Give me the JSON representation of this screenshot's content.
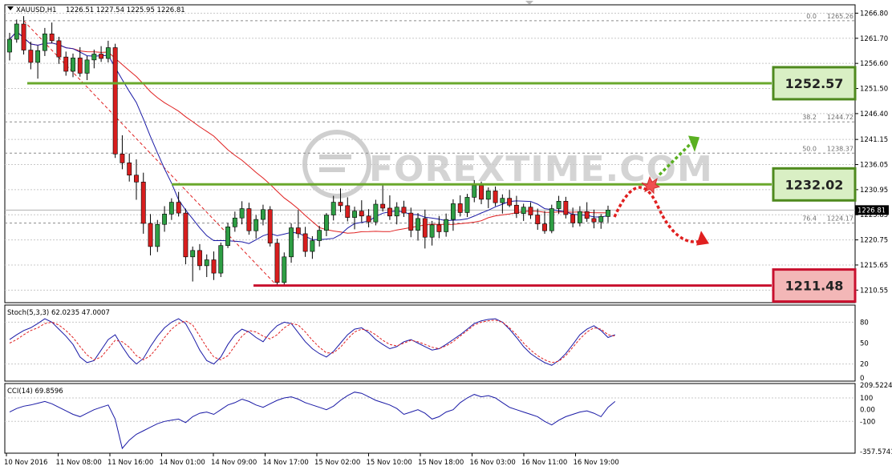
{
  "chart_data": [
    {
      "type": "candlestick",
      "title": "XAUUSD,H1",
      "ohlc_header": "1226.51 1227.54 1225.95 1226.81",
      "symbol": "XAUUSD",
      "timeframe": "H1",
      "last_price": "1226.81",
      "ylim": [
        1208.0,
        1268.5
      ],
      "y_tick_labels": [
        "1266.80",
        "1261.70",
        "1256.60",
        "1251.50",
        "1246.40",
        "1241.15",
        "1236.05",
        "1230.95",
        "1225.85",
        "1220.75",
        "1215.65",
        "1210.55"
      ],
      "x_tick_labels": [
        "10 Nov 2016",
        "11 Nov 08:00",
        "11 Nov 16:00",
        "14 Nov 01:00",
        "14 Nov 09:00",
        "14 Nov 17:00",
        "15 Nov 02:00",
        "15 Nov 10:00",
        "15 Nov 18:00",
        "16 Nov 03:00",
        "16 Nov 11:00",
        "16 Nov 19:00"
      ],
      "fibonacci_levels": [
        {
          "label": "0.0",
          "price": "1265.26",
          "value": 1265.26
        },
        {
          "label": "38.2",
          "price": "1244.72",
          "value": 1244.72
        },
        {
          "label": "50.0",
          "price": "1238.37",
          "value": 1238.37
        },
        {
          "label": "76.4",
          "price": "1224.17",
          "value": 1224.17
        }
      ],
      "key_levels": [
        {
          "label": "1252.57",
          "value": 1252.57,
          "kind": "resistance"
        },
        {
          "label": "1232.02",
          "value": 1232.02,
          "kind": "pivot"
        },
        {
          "label": "1211.48",
          "value": 1211.48,
          "kind": "support"
        }
      ],
      "candles": [
        [
          1258.9,
          1262.8,
          1257.2,
          1261.5
        ],
        [
          1261.5,
          1265.5,
          1260.8,
          1264.6
        ],
        [
          1264.6,
          1266.2,
          1258.4,
          1259.3
        ],
        [
          1259.3,
          1261.0,
          1255.4,
          1256.8
        ],
        [
          1256.8,
          1260.2,
          1253.5,
          1259.2
        ],
        [
          1259.2,
          1263.8,
          1258.1,
          1262.6
        ],
        [
          1262.6,
          1264.9,
          1260.7,
          1261.2
        ],
        [
          1261.2,
          1262.0,
          1256.5,
          1257.9
        ],
        [
          1257.9,
          1259.0,
          1254.1,
          1255.0
        ],
        [
          1255.0,
          1258.6,
          1253.8,
          1257.7
        ],
        [
          1257.7,
          1259.9,
          1253.9,
          1254.6
        ],
        [
          1254.6,
          1258.1,
          1253.2,
          1257.3
        ],
        [
          1257.3,
          1259.4,
          1255.6,
          1258.5
        ],
        [
          1258.5,
          1260.1,
          1256.9,
          1257.6
        ],
        [
          1257.6,
          1261.2,
          1256.8,
          1259.8
        ],
        [
          1259.8,
          1260.6,
          1237.4,
          1238.2
        ],
        [
          1238.2,
          1242.0,
          1235.1,
          1236.4
        ],
        [
          1236.4,
          1238.3,
          1232.6,
          1233.9
        ],
        [
          1233.9,
          1237.1,
          1228.9,
          1232.5
        ],
        [
          1232.5,
          1234.4,
          1222.0,
          1224.1
        ],
        [
          1224.1,
          1226.0,
          1217.6,
          1219.4
        ],
        [
          1219.4,
          1224.8,
          1218.3,
          1223.9
        ],
        [
          1223.9,
          1227.6,
          1222.4,
          1226.0
        ],
        [
          1226.0,
          1229.2,
          1224.8,
          1228.4
        ],
        [
          1228.4,
          1230.5,
          1225.5,
          1226.2
        ],
        [
          1226.2,
          1227.1,
          1215.8,
          1217.3
        ],
        [
          1217.3,
          1219.4,
          1212.3,
          1218.6
        ],
        [
          1218.6,
          1219.9,
          1214.6,
          1215.5
        ],
        [
          1215.5,
          1217.8,
          1213.2,
          1216.7
        ],
        [
          1216.7,
          1218.4,
          1212.6,
          1214.0
        ],
        [
          1214.0,
          1220.2,
          1213.2,
          1219.6
        ],
        [
          1219.6,
          1224.2,
          1219.1,
          1223.4
        ],
        [
          1223.4,
          1226.5,
          1222.4,
          1225.2
        ],
        [
          1225.2,
          1228.6,
          1223.9,
          1227.1
        ],
        [
          1227.1,
          1228.3,
          1221.8,
          1222.6
        ],
        [
          1222.6,
          1225.8,
          1221.0,
          1224.9
        ],
        [
          1224.9,
          1227.9,
          1223.7,
          1226.9
        ],
        [
          1226.9,
          1227.6,
          1219.4,
          1220.1
        ],
        [
          1220.1,
          1221.0,
          1211.4,
          1212.1
        ],
        [
          1212.1,
          1218.2,
          1211.6,
          1217.3
        ],
        [
          1217.3,
          1224.1,
          1216.1,
          1223.2
        ],
        [
          1223.2,
          1226.8,
          1221.1,
          1222.0
        ],
        [
          1222.0,
          1223.4,
          1217.3,
          1218.4
        ],
        [
          1218.4,
          1221.5,
          1216.9,
          1220.6
        ],
        [
          1220.6,
          1223.6,
          1219.4,
          1222.7
        ],
        [
          1222.7,
          1226.2,
          1221.5,
          1225.8
        ],
        [
          1225.8,
          1229.7,
          1224.7,
          1228.4
        ],
        [
          1228.4,
          1231.2,
          1226.4,
          1227.7
        ],
        [
          1227.7,
          1229.4,
          1224.5,
          1225.3
        ],
        [
          1225.3,
          1227.5,
          1222.9,
          1226.6
        ],
        [
          1226.6,
          1228.8,
          1224.4,
          1225.6
        ],
        [
          1225.6,
          1227.0,
          1223.3,
          1224.4
        ],
        [
          1224.4,
          1228.9,
          1223.7,
          1228.0
        ],
        [
          1228.0,
          1232.1,
          1226.5,
          1227.2
        ],
        [
          1227.2,
          1229.8,
          1224.8,
          1225.6
        ],
        [
          1225.6,
          1228.4,
          1223.9,
          1227.4
        ],
        [
          1227.4,
          1228.7,
          1225.4,
          1226.2
        ],
        [
          1226.2,
          1227.3,
          1221.3,
          1222.7
        ],
        [
          1222.7,
          1226.2,
          1220.6,
          1225.1
        ],
        [
          1225.1,
          1226.9,
          1219.0,
          1221.3
        ],
        [
          1221.3,
          1224.6,
          1219.6,
          1223.8
        ],
        [
          1223.8,
          1225.6,
          1221.1,
          1222.4
        ],
        [
          1222.4,
          1226.1,
          1221.4,
          1224.9
        ],
        [
          1224.9,
          1229.0,
          1222.6,
          1228.1
        ],
        [
          1228.1,
          1229.8,
          1225.5,
          1226.3
        ],
        [
          1226.3,
          1230.1,
          1225.4,
          1229.4
        ],
        [
          1229.4,
          1232.9,
          1228.4,
          1231.8
        ],
        [
          1231.8,
          1232.6,
          1228.0,
          1229.0
        ],
        [
          1229.0,
          1231.4,
          1227.2,
          1230.7
        ],
        [
          1230.7,
          1231.6,
          1227.6,
          1228.3
        ],
        [
          1228.3,
          1230.0,
          1226.1,
          1229.2
        ],
        [
          1229.2,
          1230.9,
          1227.4,
          1227.8
        ],
        [
          1227.8,
          1229.7,
          1225.2,
          1226.1
        ],
        [
          1226.1,
          1228.1,
          1224.6,
          1227.4
        ],
        [
          1227.4,
          1228.4,
          1225.0,
          1225.8
        ],
        [
          1225.8,
          1227.1,
          1222.8,
          1224.0
        ],
        [
          1224.0,
          1226.6,
          1222.0,
          1222.6
        ],
        [
          1222.6,
          1227.9,
          1222.1,
          1227.1
        ],
        [
          1227.1,
          1229.7,
          1226.0,
          1228.6
        ],
        [
          1228.6,
          1229.5,
          1225.1,
          1225.9
        ],
        [
          1225.9,
          1227.3,
          1223.3,
          1224.2
        ],
        [
          1224.2,
          1227.6,
          1223.5,
          1226.5
        ],
        [
          1226.5,
          1228.4,
          1224.4,
          1225.1
        ],
        [
          1225.1,
          1226.9,
          1223.1,
          1224.4
        ],
        [
          1224.4,
          1226.0,
          1223.0,
          1225.5
        ],
        [
          1225.5,
          1227.7,
          1224.3,
          1226.81
        ]
      ],
      "indicators": [
        {
          "name": "fast_ma",
          "color": "#1a1aa6"
        },
        {
          "name": "slow_ma",
          "color": "#e02020"
        }
      ],
      "forecast_arrows": [
        {
          "direction": "up",
          "color": "#5ab021"
        },
        {
          "direction": "down",
          "color": "#e02020"
        }
      ],
      "watermark": "FOREXTIME.COM"
    },
    {
      "type": "line",
      "title": "Stoch(5,3,3) 62.0235 47.0007",
      "ylim": [
        0,
        100
      ],
      "y_tick_labels": [
        "80",
        "50",
        "20",
        "0"
      ],
      "y_ticks": [
        80,
        50,
        20,
        0
      ],
      "series": [
        {
          "name": "main",
          "color": "#1a1aa6",
          "style": "solid",
          "values": [
            55,
            62,
            68,
            72,
            78,
            85,
            80,
            70,
            60,
            48,
            30,
            22,
            25,
            40,
            55,
            62,
            45,
            30,
            20,
            28,
            45,
            60,
            72,
            80,
            85,
            78,
            60,
            40,
            25,
            20,
            30,
            48,
            62,
            70,
            66,
            58,
            52,
            65,
            75,
            80,
            78,
            65,
            52,
            42,
            35,
            30,
            38,
            50,
            62,
            70,
            72,
            65,
            55,
            48,
            42,
            45,
            52,
            55,
            50,
            45,
            40,
            42,
            48,
            55,
            62,
            70,
            78,
            82,
            84,
            85,
            80,
            70,
            58,
            45,
            35,
            28,
            22,
            18,
            25,
            35,
            48,
            62,
            70,
            75,
            68,
            58,
            62
          ]
        },
        {
          "name": "signal",
          "color": "#e02020",
          "style": "dashed",
          "values": [
            50,
            55,
            62,
            68,
            72,
            78,
            80,
            76,
            68,
            58,
            45,
            33,
            26,
            30,
            42,
            54,
            52,
            44,
            32,
            26,
            32,
            44,
            58,
            70,
            78,
            82,
            76,
            60,
            44,
            30,
            26,
            32,
            46,
            60,
            68,
            66,
            60,
            56,
            62,
            72,
            78,
            76,
            66,
            54,
            44,
            36,
            36,
            44,
            56,
            66,
            70,
            68,
            62,
            54,
            48,
            46,
            50,
            54,
            52,
            48,
            44,
            42,
            46,
            52,
            60,
            68,
            76,
            80,
            82,
            83,
            80,
            72,
            62,
            50,
            40,
            32,
            26,
            22,
            24,
            32,
            44,
            56,
            66,
            72,
            70,
            62,
            60
          ]
        }
      ]
    },
    {
      "type": "line",
      "title": "CCI(14) 69.8596",
      "ylim": [
        -357.5741,
        209.5224
      ],
      "y_tick_labels": [
        "209.5224",
        "100",
        "0.00",
        "-100",
        "-357.5741"
      ],
      "y_ticks": [
        209.5224,
        100,
        0,
        -100,
        -357.5741
      ],
      "series": [
        {
          "name": "CCI",
          "color": "#1a1aa6",
          "values": [
            -20,
            10,
            30,
            40,
            55,
            70,
            50,
            20,
            -10,
            -40,
            -60,
            -30,
            0,
            20,
            40,
            -80,
            -330,
            -260,
            -210,
            -180,
            -150,
            -120,
            -100,
            -90,
            -80,
            -110,
            -60,
            -30,
            -20,
            -40,
            0,
            40,
            60,
            90,
            70,
            40,
            20,
            50,
            80,
            100,
            110,
            90,
            60,
            40,
            20,
            0,
            30,
            80,
            120,
            150,
            140,
            110,
            80,
            60,
            40,
            10,
            -40,
            -20,
            0,
            -30,
            -80,
            -60,
            -20,
            0,
            60,
            100,
            130,
            110,
            120,
            100,
            60,
            20,
            0,
            -20,
            -40,
            -60,
            -100,
            -130,
            -90,
            -60,
            -40,
            -20,
            -10,
            -30,
            -60,
            20,
            70
          ]
        }
      ]
    }
  ]
}
